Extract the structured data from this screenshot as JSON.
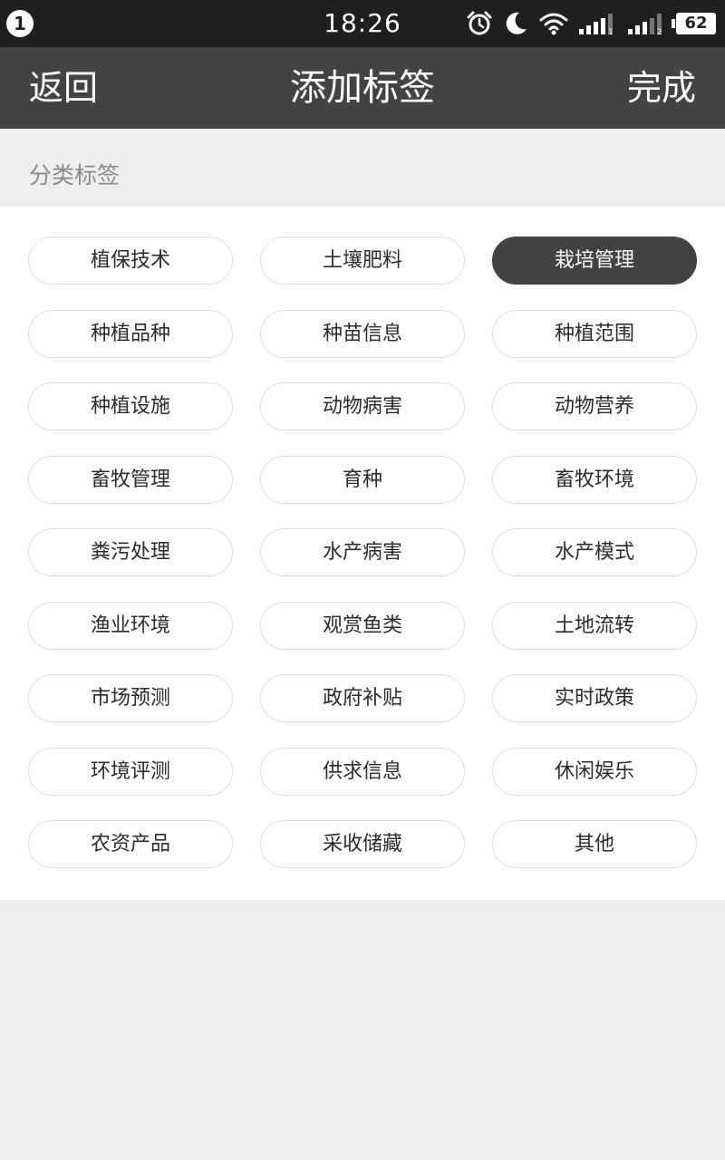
{
  "status_bar": {
    "notification_count": "1",
    "time": "18:26",
    "signal_1_label": "1",
    "signal_2_label": "2",
    "battery": "62",
    "icons": [
      "alarm-icon",
      "moon-icon",
      "wifi-icon",
      "signal-icon",
      "signal-icon",
      "battery-icon"
    ]
  },
  "header": {
    "back_label": "返回",
    "title": "添加标签",
    "done_label": "完成"
  },
  "section": {
    "label": "分类标签"
  },
  "colors": {
    "header_bg": "#434343",
    "statusbar_bg": "#1f1f1f",
    "selected_tag_bg": "#434343",
    "page_bg": "#eeeeee"
  },
  "tags": [
    {
      "label": "植保技术",
      "selected": false
    },
    {
      "label": "土壤肥料",
      "selected": false
    },
    {
      "label": "栽培管理",
      "selected": true
    },
    {
      "label": "种植品种",
      "selected": false
    },
    {
      "label": "种苗信息",
      "selected": false
    },
    {
      "label": "种植范围",
      "selected": false
    },
    {
      "label": "种植设施",
      "selected": false
    },
    {
      "label": "动物病害",
      "selected": false
    },
    {
      "label": "动物营养",
      "selected": false
    },
    {
      "label": "畜牧管理",
      "selected": false
    },
    {
      "label": "育种",
      "selected": false
    },
    {
      "label": "畜牧环境",
      "selected": false
    },
    {
      "label": "粪污处理",
      "selected": false
    },
    {
      "label": "水产病害",
      "selected": false
    },
    {
      "label": "水产模式",
      "selected": false
    },
    {
      "label": "渔业环境",
      "selected": false
    },
    {
      "label": "观赏鱼类",
      "selected": false
    },
    {
      "label": "土地流转",
      "selected": false
    },
    {
      "label": "市场预测",
      "selected": false
    },
    {
      "label": "政府补贴",
      "selected": false
    },
    {
      "label": "实时政策",
      "selected": false
    },
    {
      "label": "环境评测",
      "selected": false
    },
    {
      "label": "供求信息",
      "selected": false
    },
    {
      "label": "休闲娱乐",
      "selected": false
    },
    {
      "label": "农资产品",
      "selected": false
    },
    {
      "label": "采收储藏",
      "selected": false
    },
    {
      "label": "其他",
      "selected": false
    }
  ]
}
